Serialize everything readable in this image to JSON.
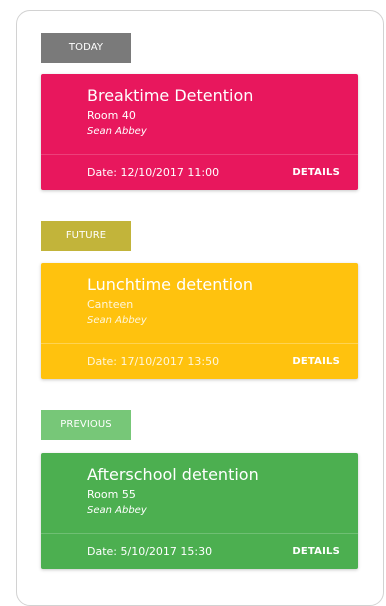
{
  "colors": {
    "today_tag": "#7a7a7a",
    "today_card": "#e8175d",
    "future_tag": "#c2b43a",
    "future_card": "#ffc20e",
    "previous_tag": "#77c778",
    "previous_card": "#4caf50"
  },
  "sections": [
    {
      "tag": "TODAY",
      "card": {
        "title": "Breaktime Detention",
        "location": "Room 40",
        "staff": "Sean Abbey",
        "date": "Date: 12/10/2017 11:00",
        "details_label": "DETAILS"
      }
    },
    {
      "tag": "FUTURE",
      "card": {
        "title": "Lunchtime detention",
        "location": "Canteen",
        "staff": "Sean Abbey",
        "date": "Date: 17/10/2017 13:50",
        "details_label": "DETAILS"
      }
    },
    {
      "tag": "PREVIOUS",
      "card": {
        "title": "Afterschool detention",
        "location": "Room 55",
        "staff": "Sean Abbey",
        "date": "Date: 5/10/2017 15:30",
        "details_label": "DETAILS"
      }
    }
  ]
}
